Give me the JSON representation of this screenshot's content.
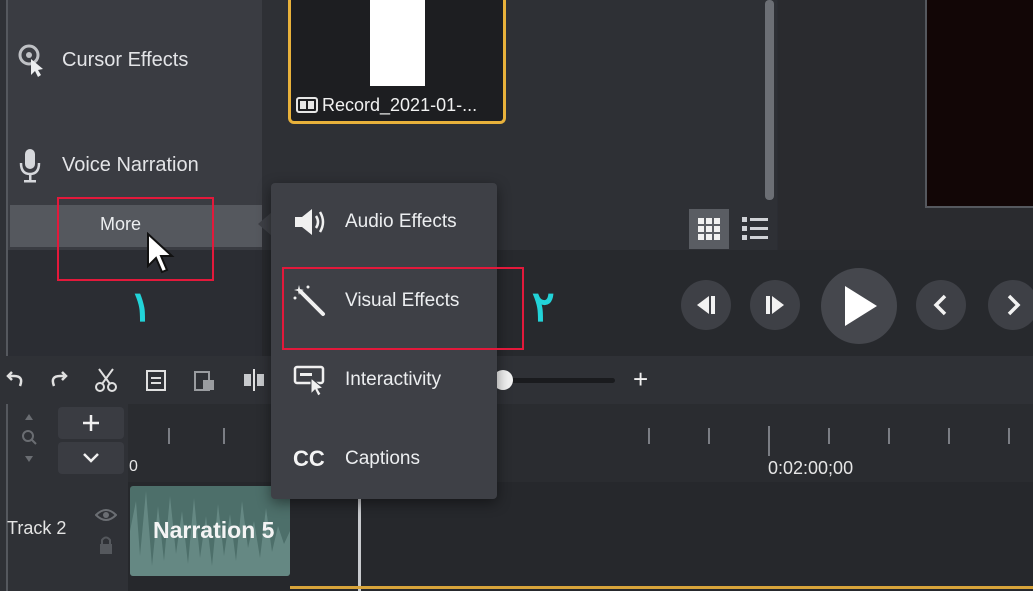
{
  "tool_panel": {
    "items": [
      {
        "label": "Cursor Effects",
        "icon": "cursor-effects-icon"
      },
      {
        "label": "Voice Narration",
        "icon": "microphone-icon"
      }
    ],
    "more_label": "More"
  },
  "media_bin": {
    "thumbnail_caption": "Record_2021-01-..."
  },
  "popup_menu": {
    "items": [
      {
        "label": "Audio Effects",
        "icon": "speaker-icon"
      },
      {
        "label": "Visual Effects",
        "icon": "magic-wand-icon"
      },
      {
        "label": "Interactivity",
        "icon": "interactivity-icon"
      },
      {
        "label": "Captions",
        "icon": "captions-icon",
        "icon_text": "CC"
      }
    ]
  },
  "timeline": {
    "ruler_start": "0",
    "ruler_mark": "0:02:00;00",
    "track_label": "Track 2",
    "clip_label": "Narration 5",
    "zoom_plus": "+"
  },
  "annotations": {
    "step1": "١",
    "step2": "٢",
    "colors": {
      "box": "#e3193b",
      "number": "#22d3d8"
    }
  }
}
